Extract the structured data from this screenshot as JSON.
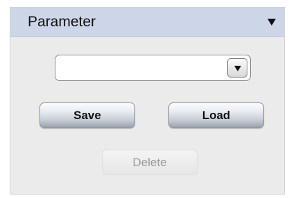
{
  "panel": {
    "title": "Parameter",
    "collapse_icon": "triangle-down-icon"
  },
  "parameter_select": {
    "selected_value": "",
    "dropdown_icon": "chevron-down-icon"
  },
  "buttons": {
    "save_label": "Save",
    "load_label": "Load",
    "delete_label": "Delete",
    "delete_enabled": false
  },
  "colors": {
    "header_bg": "#cdd5e8",
    "panel_bg": "#ebebeb",
    "disabled_text": "#9a9a9a"
  }
}
